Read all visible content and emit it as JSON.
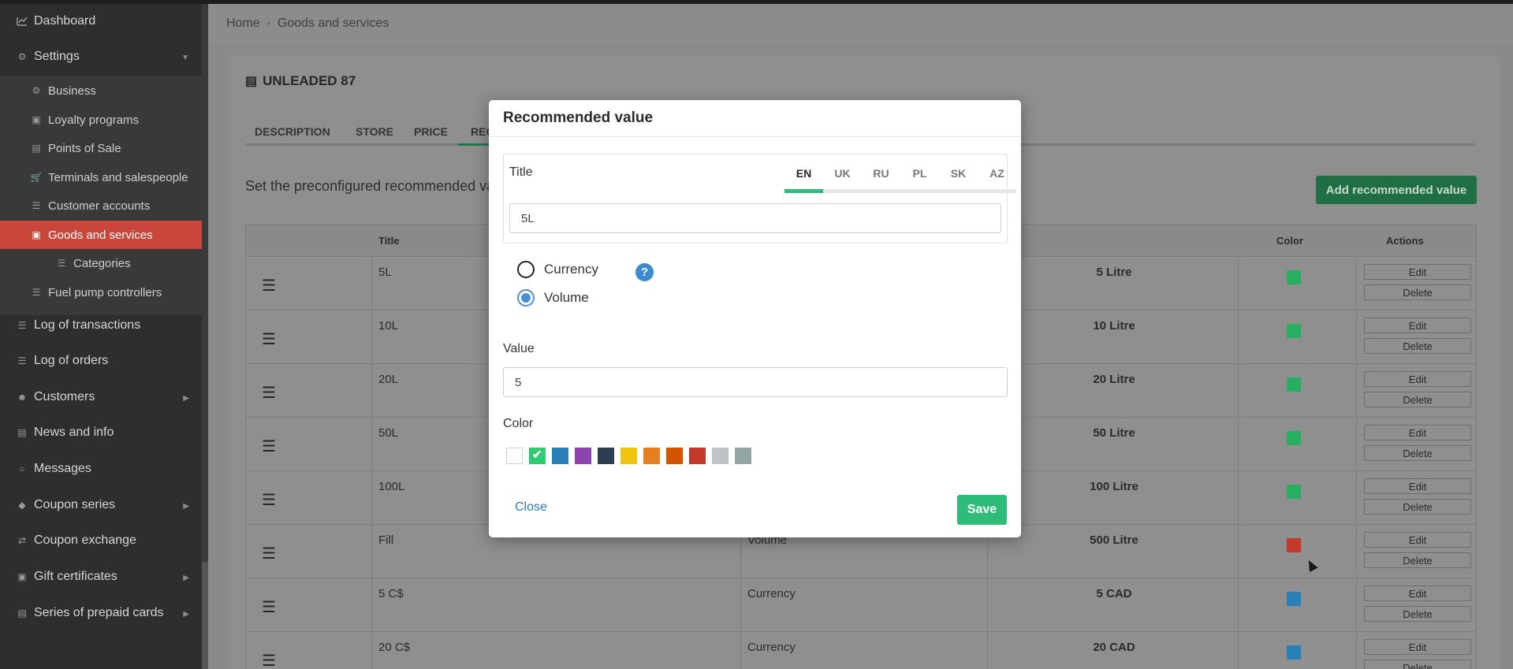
{
  "sidebar": {
    "items": [
      {
        "label": "Dashboard",
        "icon": "chart-icon"
      },
      {
        "label": "Settings",
        "icon": "gear-icon"
      },
      {
        "label": "Business",
        "icon": "gear-icon"
      },
      {
        "label": "Loyalty programs",
        "icon": "briefcase-icon"
      },
      {
        "label": "Points of Sale",
        "icon": "building-icon"
      },
      {
        "label": "Terminals and salespeople",
        "icon": "cart-icon"
      },
      {
        "label": "Customer accounts",
        "icon": "list-icon"
      },
      {
        "label": "Goods and services",
        "icon": "archive-icon"
      },
      {
        "label": "Categories",
        "icon": "list-icon"
      },
      {
        "label": "Fuel pump controllers",
        "icon": "list-icon"
      },
      {
        "label": "Log of transactions",
        "icon": "list-icon"
      },
      {
        "label": "Log of orders",
        "icon": "list-icon"
      },
      {
        "label": "Customers",
        "icon": "users-icon"
      },
      {
        "label": "News and info",
        "icon": "newspaper-icon"
      },
      {
        "label": "Messages",
        "icon": "chat-icon"
      },
      {
        "label": "Coupon series",
        "icon": "tag-icon"
      },
      {
        "label": "Coupon exchange",
        "icon": "exchange-icon"
      },
      {
        "label": "Gift certificates",
        "icon": "gift-icon"
      },
      {
        "label": "Series of prepaid cards",
        "icon": "money-icon"
      }
    ]
  },
  "breadcrumb": {
    "home": "Home",
    "current": "Goods and services"
  },
  "product": {
    "title": "UNLEADED 87"
  },
  "tabs": [
    "DESCRIPTION",
    "STORE",
    "PRICE",
    "REC"
  ],
  "intro_text": "Set the preconfigured recommended va",
  "add_button": "Add recommended value",
  "table": {
    "headers": {
      "title": "Title",
      "color": "Color",
      "actions": "Actions"
    },
    "edit_label": "Edit",
    "delete_label": "Delete",
    "rows": [
      {
        "title": "5L",
        "type": "",
        "value": "5 Litre",
        "color": "#27ae60"
      },
      {
        "title": "10L",
        "type": "",
        "value": "10 Litre",
        "color": "#27ae60"
      },
      {
        "title": "20L",
        "type": "",
        "value": "20 Litre",
        "color": "#27ae60"
      },
      {
        "title": "50L",
        "type": "",
        "value": "50 Litre",
        "color": "#27ae60"
      },
      {
        "title": "100L",
        "type": "",
        "value": "100 Litre",
        "color": "#27ae60"
      },
      {
        "title": "Fill",
        "type": "Volume",
        "value": "500 Litre",
        "color": "#c0392b"
      },
      {
        "title": "5 C$",
        "type": "Currency",
        "value": "5 CAD",
        "color": "#2980b9"
      },
      {
        "title": "20 C$",
        "type": "Currency",
        "value": "20 CAD",
        "color": "#2980b9"
      }
    ]
  },
  "modal": {
    "title": "Recommended value",
    "title_label": "Title",
    "languages": [
      "EN",
      "UK",
      "RU",
      "PL",
      "SK",
      "AZ"
    ],
    "active_language": "EN",
    "title_value": "5L",
    "radio_currency": "Currency",
    "radio_volume": "Volume",
    "selected_type": "Volume",
    "value_label": "Value",
    "value_value": "5",
    "color_label": "Color",
    "colors": [
      "#ffffff",
      "#2ecc71",
      "#2980b9",
      "#8e44ad",
      "#2c3e50",
      "#f1c40f",
      "#e67e22",
      "#d35400",
      "#c0392b",
      "#bdc3c7",
      "#95a5a6"
    ],
    "selected_color": "#2ecc71",
    "close_label": "Close",
    "save_label": "Save"
  }
}
